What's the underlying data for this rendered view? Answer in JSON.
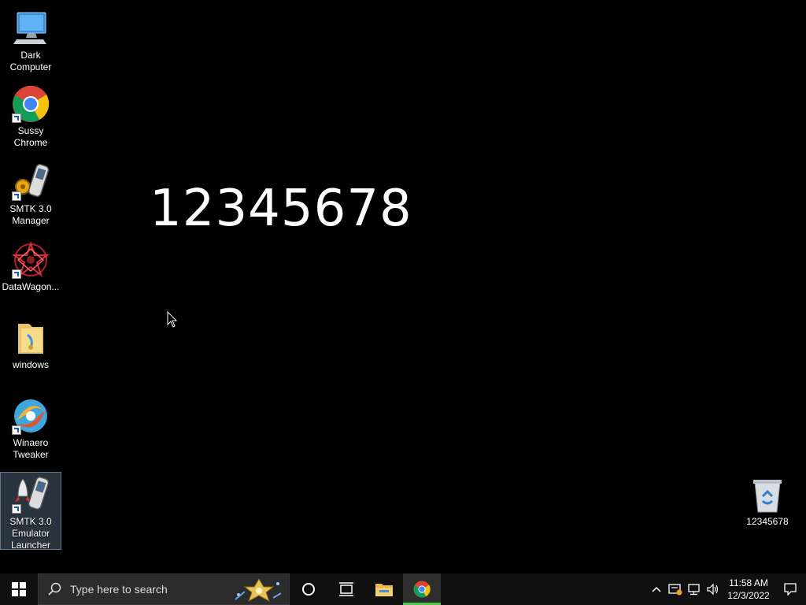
{
  "desktop": {
    "icons": [
      {
        "label": "Dark\nComputer",
        "line1": "Dark",
        "line2": "Computer"
      },
      {
        "line1": "Sussy",
        "line2": "Chrome"
      },
      {
        "line1": "SMTK 3.0",
        "line2": "Manager"
      },
      {
        "line1": "DataWagon..."
      },
      {
        "line1": "windows"
      },
      {
        "line1": "Winaero",
        "line2": "Tweaker"
      },
      {
        "line1": "SMTK 3.0",
        "line2": "Emulator",
        "line3": "Launcher"
      },
      {
        "line1": "12345678"
      }
    ],
    "big_text": "12345678"
  },
  "taskbar": {
    "search_placeholder": "Type here to search",
    "clock_time": "11:58 AM",
    "clock_date": "12/3/2022"
  },
  "colors": {
    "background": "#000000",
    "taskbar": "#101010",
    "accent": "#76b9ed"
  }
}
